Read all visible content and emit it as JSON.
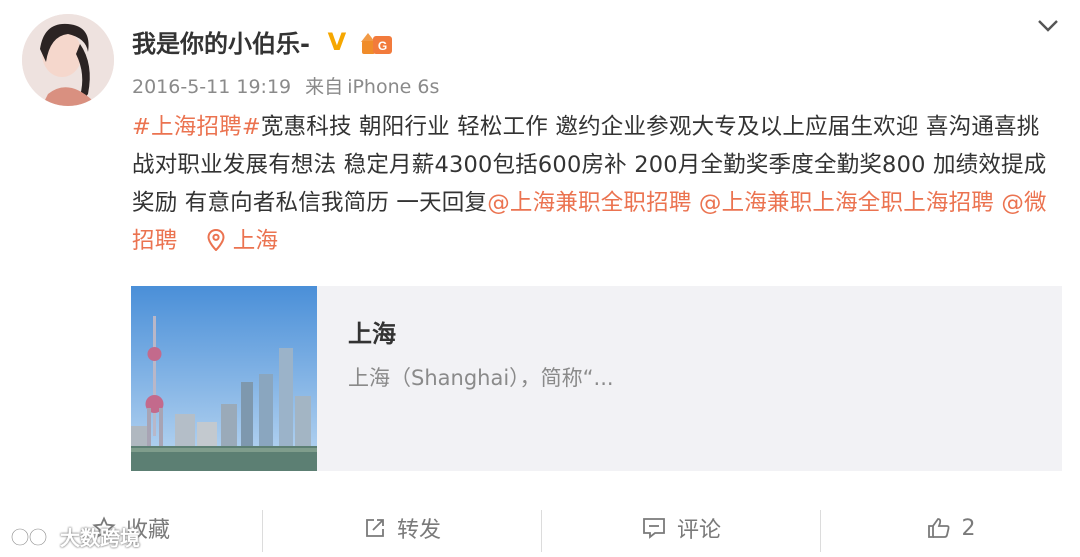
{
  "post": {
    "username": "我是你的小伯乐-",
    "verified_icon": "v-verified-icon",
    "level_icon": "user-level-badge-icon",
    "time": "2016-5-11 19:19",
    "source_prefix": "来自",
    "source": "iPhone 6s",
    "hashtag": "#上海招聘#",
    "body": "宽惠科技 朝阳行业 轻松工作 邀约企业参观大专及以上应届生欢迎 喜沟通喜挑战对职业发展有想法 稳定月薪4300包括600房补 200月全勤奖季度全勤奖800 加绩效提成奖励 有意向者私信我简历 一天回复",
    "mention1": "@上海兼职全职招聘",
    "mention2": "@上海兼职上海全职上海招聘",
    "mention3": "@微招聘",
    "location": "上海",
    "accent_color": "#eb7350"
  },
  "card": {
    "title": "上海",
    "description": "上海（Shanghai），简称“..."
  },
  "actions": {
    "favorite": "收藏",
    "repost": "转发",
    "comment": "评论",
    "like_count": "2"
  },
  "watermark": {
    "text": "大数跨境"
  }
}
